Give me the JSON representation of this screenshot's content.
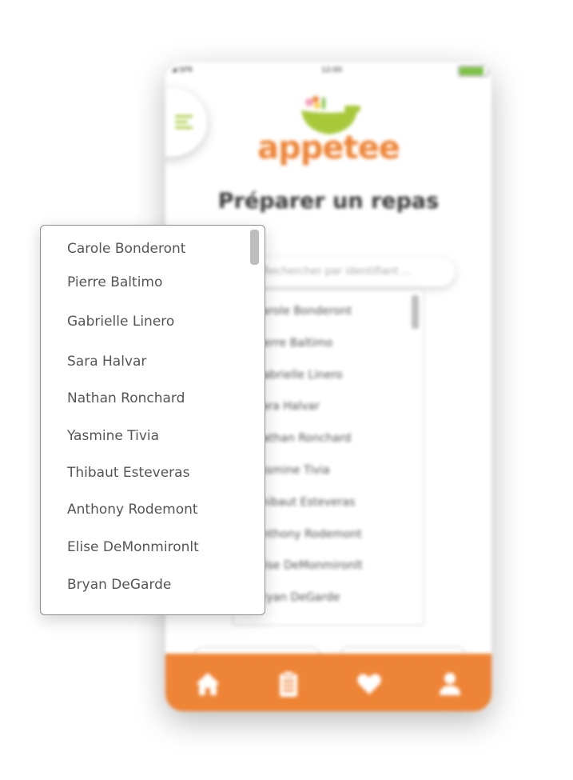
{
  "phone": {
    "status": {
      "carrier": "SFR",
      "time": "12:00",
      "battery_level": 0.95
    },
    "logo_text": "appetee",
    "title": "Préparer un repas",
    "search": {
      "placeholder": "Rechercher par identifiant ..."
    },
    "list_items": [
      "Carole Bonderont",
      "Pierre Baltimo",
      "Gabrielle Linero",
      "Sara Halvar",
      "Nathan Ronchard",
      "Yasmine Tivia",
      "Thibaut Esteveras",
      "Anthony Rodemont",
      "Elise DeMonmironlt",
      "Bryan DeGarde"
    ],
    "nav": [
      {
        "icon": "home-icon"
      },
      {
        "icon": "clipboard-list-icon"
      },
      {
        "icon": "heart-icon"
      },
      {
        "icon": "user-icon"
      }
    ]
  },
  "dropdown": {
    "items": [
      "Carole Bonderont",
      "Pierre Baltimo",
      "Gabrielle Linero",
      "Sara Halvar",
      "Nathan Ronchard",
      "Yasmine Tivia",
      "Thibaut Esteveras",
      "Anthony Rodemont",
      "Elise DeMonmironlt",
      "Bryan DeGarde"
    ]
  },
  "colors": {
    "brand_orange": "#ee8435",
    "brand_green": "#a8c83a",
    "text_gray": "#555555"
  }
}
